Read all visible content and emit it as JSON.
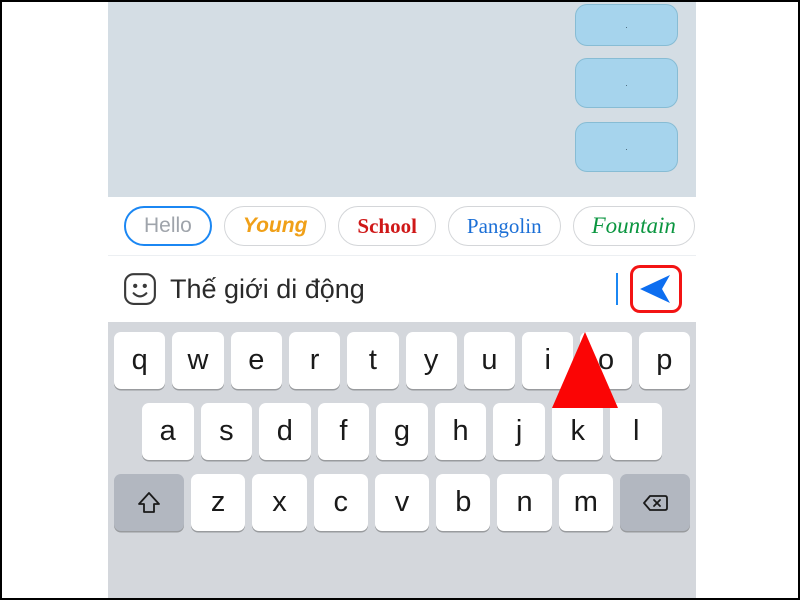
{
  "chat": {
    "bubbles": [
      ".",
      ".",
      "."
    ]
  },
  "fontChips": [
    {
      "label": "Hello",
      "style": "selected"
    },
    {
      "label": "Young",
      "style": "young"
    },
    {
      "label": "School",
      "style": "school"
    },
    {
      "label": "Pangolin",
      "style": "pangolin"
    },
    {
      "label": "Fountain",
      "style": "fountain"
    }
  ],
  "input": {
    "text": "Thế giới di động"
  },
  "keyboard": {
    "row1": [
      "q",
      "w",
      "e",
      "r",
      "t",
      "y",
      "u",
      "i",
      "o",
      "p"
    ],
    "row2": [
      "a",
      "s",
      "d",
      "f",
      "g",
      "h",
      "j",
      "k",
      "l"
    ],
    "row3": [
      "z",
      "x",
      "c",
      "v",
      "b",
      "n",
      "m"
    ]
  }
}
